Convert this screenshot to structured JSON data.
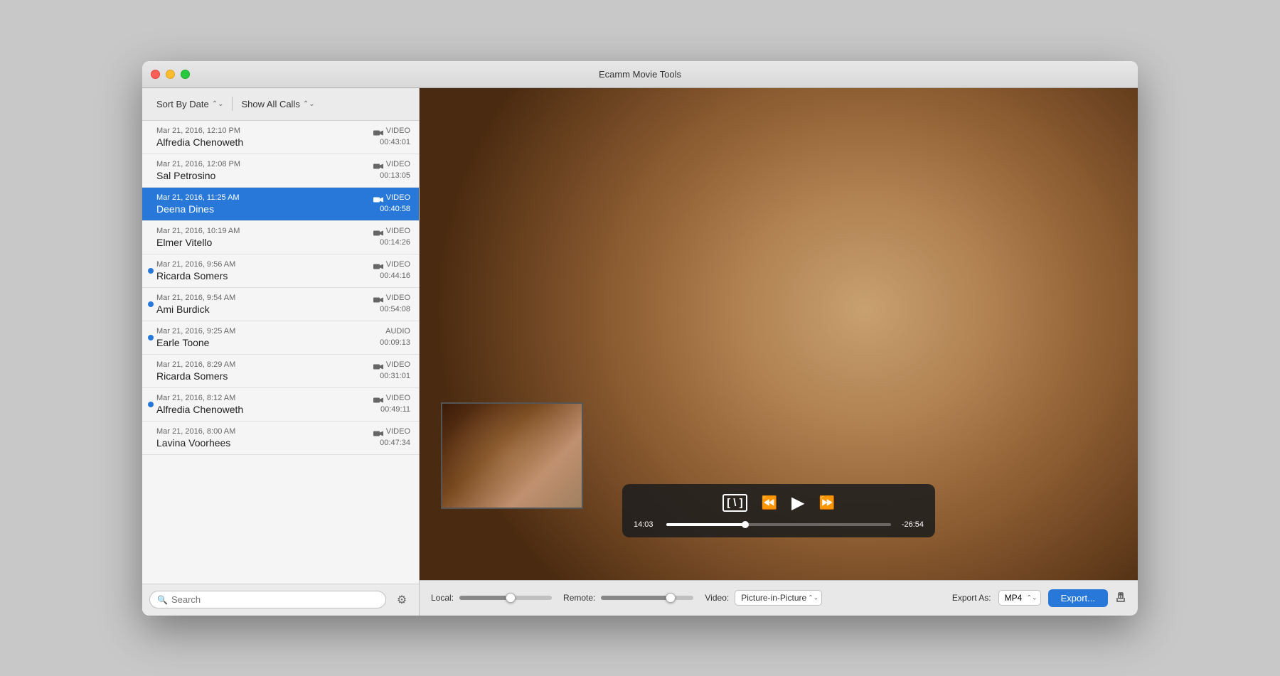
{
  "window": {
    "title": "Ecamm Movie Tools"
  },
  "sidebar": {
    "toolbar": {
      "sort_label": "Sort By Date",
      "show_label": "Show All Calls"
    },
    "calls": [
      {
        "id": 1,
        "date": "Mar 21, 2016, 12:10 PM",
        "name": "Alfredia Chenoweth",
        "type": "VIDEO",
        "duration": "00:43:01",
        "selected": false,
        "unread": false,
        "has_video_icon": true
      },
      {
        "id": 2,
        "date": "Mar 21, 2016, 12:08 PM",
        "name": "Sal Petrosino",
        "type": "VIDEO",
        "duration": "00:13:05",
        "selected": false,
        "unread": false,
        "has_video_icon": true
      },
      {
        "id": 3,
        "date": "Mar 21, 2016, 11:25 AM",
        "name": "Deena Dines",
        "type": "VIDEO",
        "duration": "00:40:58",
        "selected": true,
        "unread": false,
        "has_video_icon": true
      },
      {
        "id": 4,
        "date": "Mar 21, 2016, 10:19 AM",
        "name": "Elmer Vitello",
        "type": "VIDEO",
        "duration": "00:14:26",
        "selected": false,
        "unread": false,
        "has_video_icon": true
      },
      {
        "id": 5,
        "date": "Mar 21, 2016, 9:56 AM",
        "name": "Ricarda Somers",
        "type": "VIDEO",
        "duration": "00:44:16",
        "selected": false,
        "unread": true,
        "has_video_icon": true
      },
      {
        "id": 6,
        "date": "Mar 21, 2016, 9:54 AM",
        "name": "Ami Burdick",
        "type": "VIDEO",
        "duration": "00:54:08",
        "selected": false,
        "unread": true,
        "has_video_icon": true
      },
      {
        "id": 7,
        "date": "Mar 21, 2016, 9:25 AM",
        "name": "Earle Toone",
        "type": "AUDIO",
        "duration": "00:09:13",
        "selected": false,
        "unread": true,
        "has_video_icon": false
      },
      {
        "id": 8,
        "date": "Mar 21, 2016, 8:29 AM",
        "name": "Ricarda Somers",
        "type": "VIDEO",
        "duration": "00:31:01",
        "selected": false,
        "unread": false,
        "has_video_icon": true
      },
      {
        "id": 9,
        "date": "Mar 21, 2016, 8:12 AM",
        "name": "Alfredia Chenoweth",
        "type": "VIDEO",
        "duration": "00:49:11",
        "selected": false,
        "unread": true,
        "has_video_icon": true
      },
      {
        "id": 10,
        "date": "Mar 21, 2016, 8:00 AM",
        "name": "Lavina Voorhees",
        "type": "VIDEO",
        "duration": "00:47:34",
        "selected": false,
        "unread": false,
        "has_video_icon": true
      }
    ],
    "search": {
      "placeholder": "Search"
    }
  },
  "player": {
    "time_current": "14:03",
    "time_remaining": "-26:54",
    "progress_percent": 35
  },
  "bottombar": {
    "local_label": "Local:",
    "remote_label": "Remote:",
    "video_label": "Video:",
    "video_option": "Picture-in-Picture",
    "export_label": "Export As:",
    "export_format": "MP4",
    "export_button": "Export..."
  }
}
